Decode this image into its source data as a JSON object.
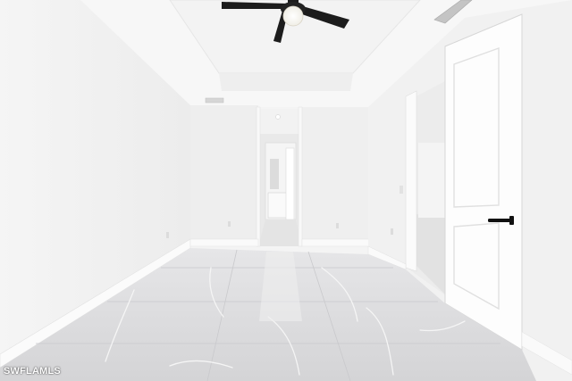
{
  "watermark": "SWFLAMLS",
  "colors": {
    "wall": "#f1f1f1",
    "ceiling": "#f7f7f7",
    "floor": "#d9d9db",
    "trim": "#ffffff",
    "fan": "#1c1c1c",
    "handle": "#111111"
  },
  "icons": [
    "ceiling-fan-icon",
    "door-handle-icon",
    "air-vent-icon"
  ]
}
